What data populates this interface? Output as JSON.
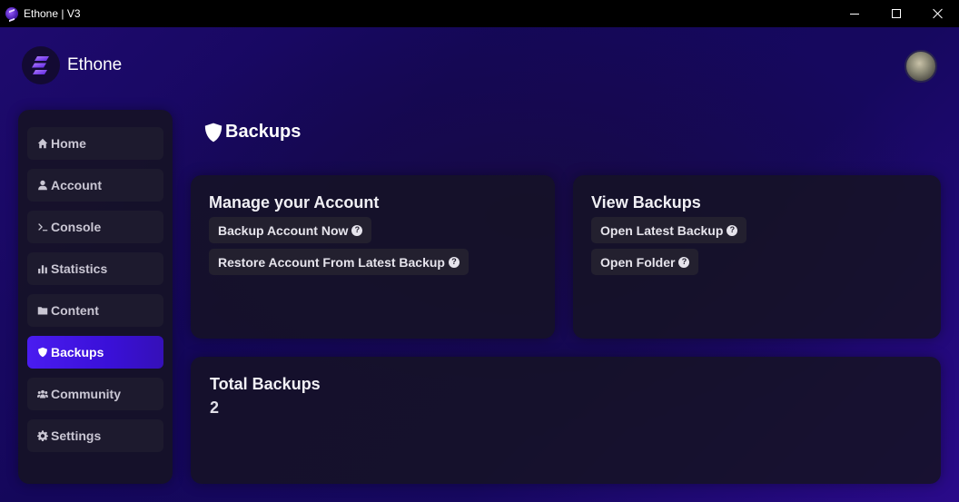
{
  "window": {
    "title": "Ethone | V3"
  },
  "brand": {
    "name": "Ethone",
    "logo_icon": "ethone-logo-icon"
  },
  "user": {
    "avatar_icon": "user-avatar"
  },
  "sidebar": {
    "items": [
      {
        "label": "Home",
        "icon": "home-icon",
        "active": false
      },
      {
        "label": "Account",
        "icon": "user-icon",
        "active": false
      },
      {
        "label": "Console",
        "icon": "terminal-icon",
        "active": false
      },
      {
        "label": "Statistics",
        "icon": "bar-chart-icon",
        "active": false
      },
      {
        "label": "Content",
        "icon": "folder-icon",
        "active": false
      },
      {
        "label": "Backups",
        "icon": "shield-icon",
        "active": true
      },
      {
        "label": "Community",
        "icon": "users-icon",
        "active": false
      },
      {
        "label": "Settings",
        "icon": "gear-icon",
        "active": false
      }
    ]
  },
  "page": {
    "title": "Backups",
    "title_icon": "shield-icon"
  },
  "manage_card": {
    "title": "Manage your Account",
    "buttons": [
      {
        "label": "Backup Account Now"
      },
      {
        "label": "Restore Account From Latest Backup"
      }
    ]
  },
  "view_card": {
    "title": "View Backups",
    "buttons": [
      {
        "label": "Open Latest Backup"
      },
      {
        "label": "Open Folder"
      }
    ]
  },
  "total_card": {
    "title": "Total Backups",
    "value": "2"
  },
  "colors": {
    "accent": "#4a1cf0",
    "background": "#16085f",
    "card": "#161226"
  }
}
